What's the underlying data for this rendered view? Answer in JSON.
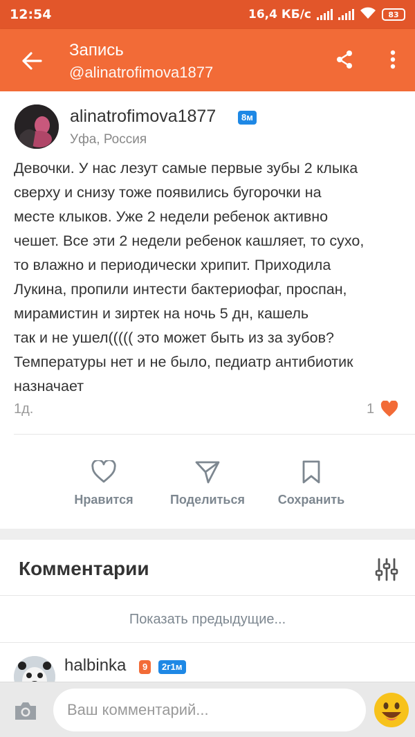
{
  "status_bar": {
    "time": "12:54",
    "network_speed": "16,4 КБ/с",
    "battery": "83"
  },
  "app_bar": {
    "title": "Запись",
    "subtitle": "@alinatrofimova1877"
  },
  "post": {
    "author": "alinatrofimova1877",
    "author_badge": "8м",
    "location": "Уфа, Россия",
    "text": "Девочки. У нас лезут самые первые зубы 2 клыка\nсверху и снизу тоже появились бугорочки на\nместе клыков. Уже 2 недели ребенок активно\nчешет. Все эти 2 недели ребенок кашляет, то сухо,\nто влажно и периодически хрипит. Приходила\nЛукина, пропили интести бактериофаг, проспан,\nмирамистин и зиртек на ночь 5 дн, кашель\nтак и не ушел((((( это может быть из за зубов?\nТемпературы нет и не было, педиатр антибиотик\nназначает",
    "time_ago": "1д.",
    "likes": "1"
  },
  "actions": {
    "like_label": "Нравится",
    "share_label": "Поделиться",
    "save_label": "Сохранить"
  },
  "comments": {
    "title": "Комментарии",
    "show_previous": "Показать предыдущие...",
    "items": [
      {
        "author": "halbinka",
        "badge_level": "9",
        "badge_age": "2г1м"
      }
    ]
  },
  "input": {
    "placeholder": "Ваш комментарий..."
  },
  "colors": {
    "status_bar": "#e2562a",
    "app_bar": "#f26b37",
    "badge_blue": "#1e88e5",
    "heart": "#f26b37",
    "action_gray": "#7d8790"
  }
}
